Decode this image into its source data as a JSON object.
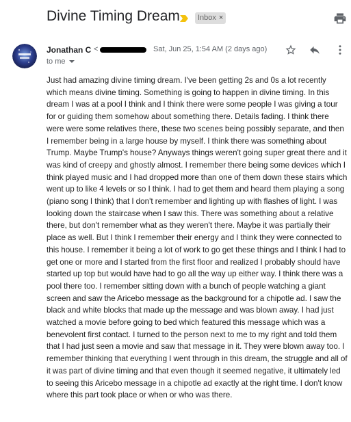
{
  "email": {
    "subject": "Divine Timing Dream",
    "label": "Inbox",
    "label_close": "×",
    "sender_name": "Jonathan C",
    "sender_email_prefix": "<",
    "date": "Sat, Jun 25, 1:54 AM (2 days ago)",
    "recipients": "to me",
    "body": "Just had amazing divine timing dream. I've been getting 2s and 0s a lot recently which means divine timing. Something is going to happen in divine timing. In this dream I was at a pool I think and I think there were some people I was giving a tour for or guiding them somehow about something there. Details fading. I think there were were some relatives there, these two scenes being possibly separate, and then I remember being in a large house by myself. I think there was something about Trump. Maybe Trump's house? Anyways things weren't going super great there and it was kind of creepy and ghostly almost. I remember there being some devices which I think played music and I had dropped more than one of them down these stairs which went up to like 4 levels or so I think. I had to get them and heard them playing a song (piano song I think) that I don't remember and lighting up with flashes of light. I was looking down the staircase when I saw this. There was something about a relative there, but don't remember what as they weren't there. Maybe it was partially their place as well. But I think I remember their energy and I think they were connected to this house. I remember it being a lot of work to go get these things and I think I had to get one or more and I started from the first floor and realized I probably should have started up top but would have had to go all the way up either way. I think there was a pool there too. I remember sitting down with a bunch of people watching a giant screen and saw the Aricebo message as the background for a chipotle ad. I saw the black and white blocks that made up the message and was blown away. I had just watched a movie before going to bed which featured this message which was a benevolent first contact. I turned to the person next to me to my right and told them that I had just seen a movie and saw that message in it. They were blown away too. I remember thinking that everything I went through in this dream, the struggle and all of it was part of divine timing and that even though it seemed negative, it ultimately led to seeing this Aricebo message in a chipotle ad exactly at the right time. I don't know where this part took place or when or who was there."
  },
  "icons": {
    "important": "important-marker-icon",
    "print": "print-icon",
    "star": "star-icon",
    "reply": "reply-icon",
    "more": "more-vert-icon",
    "dropdown": "caret-down-icon"
  },
  "colors": {
    "important_marker": "#f4c20d",
    "label_bg": "#dddddd",
    "text": "#202124",
    "muted": "#5f6368"
  }
}
